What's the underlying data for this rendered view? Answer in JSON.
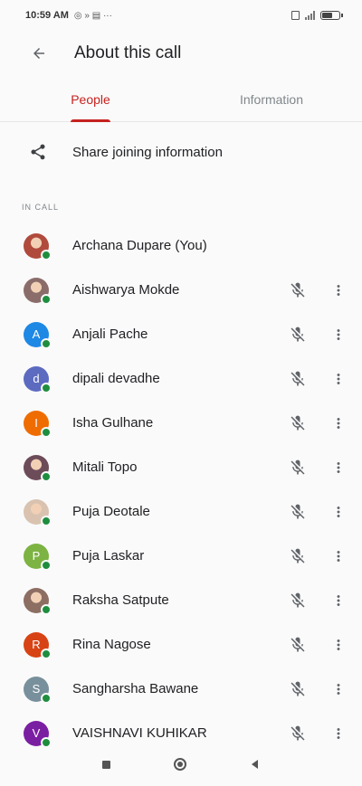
{
  "status_bar": {
    "time": "10:59 AM",
    "notif_icons": "◎ » ▤ ···",
    "battery_level": 0.7
  },
  "header": {
    "title": "About this call"
  },
  "tabs": [
    {
      "label": "People",
      "active": true
    },
    {
      "label": "Information",
      "active": false
    }
  ],
  "share": {
    "label": "Share joining information"
  },
  "section": {
    "label": "IN CALL"
  },
  "participants": [
    {
      "name": "Archana Dupare (You)",
      "avatar_letter": "",
      "avatar_color": "#b04a3c",
      "photo": true,
      "is_you": true
    },
    {
      "name": "Aishwarya Mokde",
      "avatar_letter": "",
      "avatar_color": "#8a6d6a",
      "photo": true,
      "is_you": false
    },
    {
      "name": "Anjali Pache",
      "avatar_letter": "A",
      "avatar_color": "#1e88e5",
      "photo": false,
      "is_you": false
    },
    {
      "name": "dipali devadhe",
      "avatar_letter": "d",
      "avatar_color": "#5c6bc0",
      "photo": false,
      "is_you": false
    },
    {
      "name": "Isha Gulhane",
      "avatar_letter": "I",
      "avatar_color": "#ef6c00",
      "photo": false,
      "is_you": false
    },
    {
      "name": "Mitali Topo",
      "avatar_letter": "",
      "avatar_color": "#6d4c5a",
      "photo": true,
      "is_you": false
    },
    {
      "name": "Puja Deotale",
      "avatar_letter": "",
      "avatar_color": "#d9c3b0",
      "photo": true,
      "is_you": false
    },
    {
      "name": "Puja Laskar",
      "avatar_letter": "P",
      "avatar_color": "#7cb342",
      "photo": false,
      "is_you": false
    },
    {
      "name": "Raksha Satpute",
      "avatar_letter": "",
      "avatar_color": "#8d6e63",
      "photo": true,
      "is_you": false
    },
    {
      "name": "Rina Nagose",
      "avatar_letter": "R",
      "avatar_color": "#d84315",
      "photo": false,
      "is_you": false
    },
    {
      "name": "Sangharsha Bawane",
      "avatar_letter": "S",
      "avatar_color": "#78909c",
      "photo": false,
      "is_you": false
    },
    {
      "name": "VAISHNAVI KUHIKAR",
      "avatar_letter": "V",
      "avatar_color": "#7b1fa2",
      "photo": false,
      "is_you": false
    }
  ],
  "icons": {
    "back": "arrow-back-icon",
    "share": "share-icon",
    "mic_off": "mic-off-icon",
    "more": "more-vert-icon",
    "nav_recents": "square-icon",
    "nav_home": "circle-icon",
    "nav_back": "triangle-back-icon"
  },
  "colors": {
    "accent": "#c5221f",
    "online": "#1e8e3e"
  }
}
